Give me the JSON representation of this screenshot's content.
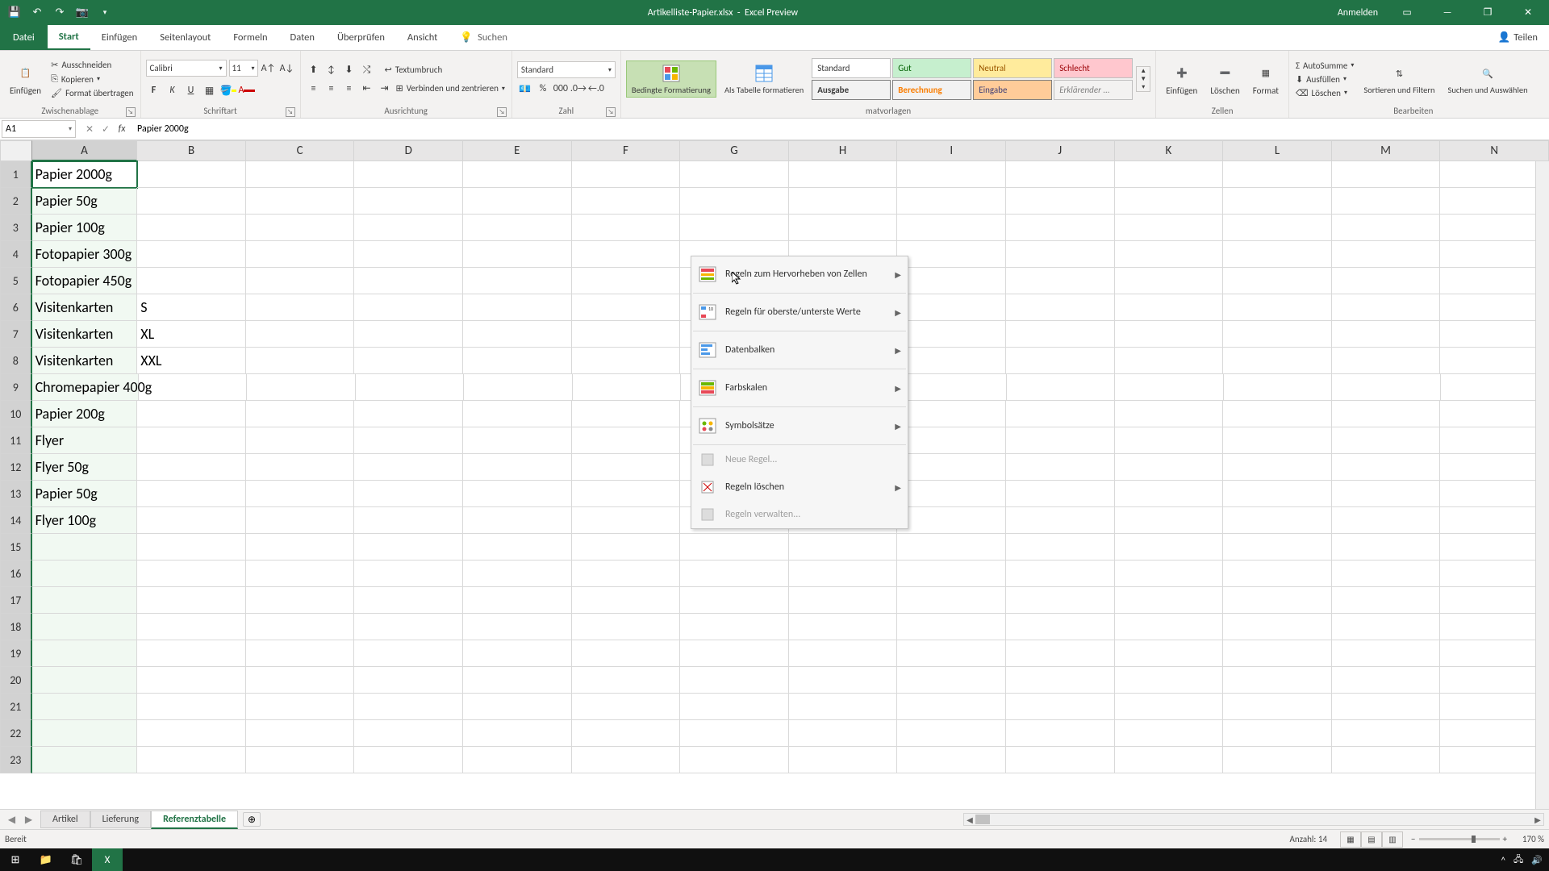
{
  "title": {
    "doc": "Artikelliste-Papier.xlsx",
    "suffix": "Excel Preview"
  },
  "signin": "Anmelden",
  "share": "Teilen",
  "tabs": {
    "file": "Datei",
    "start": "Start",
    "einfuegen": "Einfügen",
    "seitenlayout": "Seitenlayout",
    "formeln": "Formeln",
    "daten": "Daten",
    "ueberpruefen": "Überprüfen",
    "ansicht": "Ansicht",
    "suchen": "Suchen"
  },
  "ribbon": {
    "clipboard": {
      "einfuegen": "Einfügen",
      "ausschneiden": "Ausschneiden",
      "kopieren": "Kopieren",
      "format": "Format übertragen",
      "label": "Zwischenablage"
    },
    "font": {
      "name": "Calibri",
      "size": "11",
      "label": "Schriftart"
    },
    "align": {
      "wrap": "Textumbruch",
      "merge": "Verbinden und zentrieren",
      "label": "Ausrichtung"
    },
    "number": {
      "format": "Standard",
      "label": "Zahl"
    },
    "styles": {
      "cond": "Bedingte Formatierung",
      "table": "Als Tabelle formatieren",
      "label": "matvorlagen",
      "standard": "Standard",
      "gut": "Gut",
      "neutral": "Neutral",
      "schlecht": "Schlecht",
      "ausgabe": "Ausgabe",
      "berechnung": "Berechnung",
      "eingabe": "Eingabe",
      "erkl": "Erklärender ..."
    },
    "cells": {
      "insert": "Einfügen",
      "delete": "Löschen",
      "format": "Format",
      "label": "Zellen"
    },
    "edit": {
      "sum": "AutoSumme",
      "fill": "Ausfüllen",
      "clear": "Löschen",
      "sort": "Sortieren und Filtern",
      "find": "Suchen und Auswählen",
      "label": "Bearbeiten"
    }
  },
  "dropdown": {
    "highlight": "Regeln zum Hervorheben von Zellen",
    "toprules": "Regeln für oberste/unterste Werte",
    "databars": "Datenbalken",
    "colorscales": "Farbskalen",
    "iconsets": "Symbolsätze",
    "newrule": "Neue Regel...",
    "clearrules": "Regeln löschen",
    "manage": "Regeln verwalten..."
  },
  "namebox": "A1",
  "formula": "Papier 2000g",
  "columns": [
    "A",
    "B",
    "C",
    "D",
    "E",
    "F",
    "G",
    "H",
    "I",
    "J",
    "K",
    "L",
    "M",
    "N"
  ],
  "rowcount": 23,
  "cells": {
    "1": {
      "A": "Papier 2000g"
    },
    "2": {
      "A": "Papier 50g"
    },
    "3": {
      "A": "Papier 100g"
    },
    "4": {
      "A": "Fotopapier 300g"
    },
    "5": {
      "A": "Fotopapier 450g"
    },
    "6": {
      "A": "Visitenkarten",
      "B": "S"
    },
    "7": {
      "A": "Visitenkarten",
      "B": "XL"
    },
    "8": {
      "A": "Visitenkarten",
      "B": "XXL"
    },
    "9": {
      "A": "Chromepapier 400g"
    },
    "10": {
      "A": "Papier 200g"
    },
    "11": {
      "A": "Flyer"
    },
    "12": {
      "A": "Flyer 50g"
    },
    "13": {
      "A": "Papier 50g"
    },
    "14": {
      "A": "Flyer 100g"
    }
  },
  "sheets": {
    "s1": "Artikel",
    "s2": "Lieferung",
    "s3": "Referenztabelle"
  },
  "status": {
    "ready": "Bereit",
    "count_label": "Anzahl:",
    "count": "14",
    "zoom": "170 %"
  }
}
